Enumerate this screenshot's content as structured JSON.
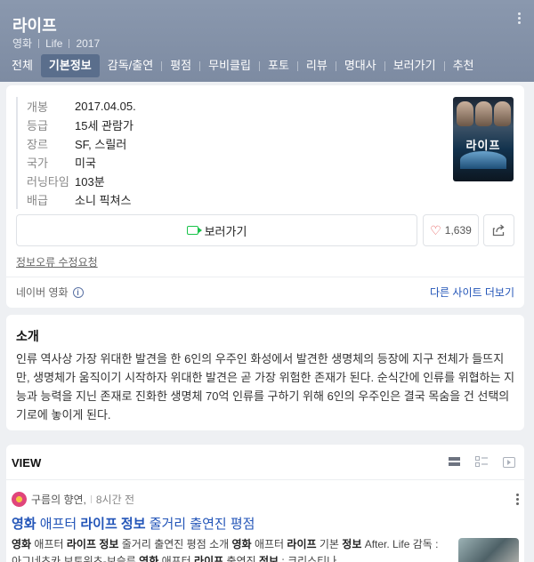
{
  "header": {
    "title": "라이프",
    "meta": [
      "영화",
      "Life",
      "2017"
    ]
  },
  "tabs": [
    "전체",
    "기본정보",
    "감독/출연",
    "평점",
    "무비클립",
    "포토",
    "리뷰",
    "명대사",
    "보러가기",
    "추천"
  ],
  "active_tab": "기본정보",
  "info": [
    {
      "key": "개봉",
      "value": "2017.04.05."
    },
    {
      "key": "등급",
      "value": "15세 관람가"
    },
    {
      "key": "장르",
      "value": "SF, 스릴러"
    },
    {
      "key": "국가",
      "value": "미국"
    },
    {
      "key": "러닝타임",
      "value": "103분"
    },
    {
      "key": "배급",
      "value": "소니 픽쳐스"
    }
  ],
  "poster": {
    "title": "라이프"
  },
  "actions": {
    "watch_label": "보러가기",
    "like_count": "1,639",
    "report_label": "정보오류 수정요청",
    "source_label": "네이버 영화",
    "other_sites_label": "다른 사이트 더보기"
  },
  "intro": {
    "title": "소개",
    "text": "인류 역사상 가장 위대한 발견을 한 6인의 우주인 화성에서 발견한 생명체의 등장에 지구 전체가 들뜨지만, 생명체가 움직이기 시작하자 위대한 발견은 곧 가장 위험한 존재가 된다. 순식간에 인류를 위협하는 지능과 능력을 지닌 존재로 진화한 생명체 70억 인류를 구하기 위해 6인의 우주인은 결국 목숨을 건 선택의 기로에 놓이게 된다."
  },
  "view": {
    "title": "VIEW",
    "post": {
      "author": "구름의 향연,",
      "time": "8시간 전",
      "title_parts": [
        {
          "text": "영화",
          "bold": true
        },
        {
          "text": " 애프터 ",
          "bold": false
        },
        {
          "text": "라이프 정보",
          "bold": true
        },
        {
          "text": " 줄거리 출연진 평점",
          "bold": false
        }
      ],
      "body_parts": [
        {
          "text": "영화",
          "bold": true
        },
        {
          "text": " 애프터 ",
          "bold": false
        },
        {
          "text": "라이프 정보",
          "bold": true
        },
        {
          "text": " 줄거리 출연진 평점 소개 ",
          "bold": false
        },
        {
          "text": "영화",
          "bold": true
        },
        {
          "text": " 애프터 ",
          "bold": false
        },
        {
          "text": "라이프",
          "bold": true
        },
        {
          "text": " 기본 ",
          "bold": false
        },
        {
          "text": "정보",
          "bold": true
        },
        {
          "text": " After. Life 감독 : 아그네츠카 보토위츠-보슬루 ",
          "bold": false
        },
        {
          "text": "영화",
          "bold": true
        },
        {
          "text": " 애프터 ",
          "bold": false
        },
        {
          "text": "라이프",
          "bold": true
        },
        {
          "text": " 출연진 ",
          "bold": false
        },
        {
          "text": "정보",
          "bold": true
        },
        {
          "text": " : 크리스티나",
          "bold": false
        }
      ]
    }
  },
  "colors": {
    "header_bg": "#8a98ae",
    "active_tab_bg": "#5a6e8c",
    "link_blue": "#2355b8",
    "watch_green": "#19c34a",
    "heart_red": "#e34b4b"
  }
}
